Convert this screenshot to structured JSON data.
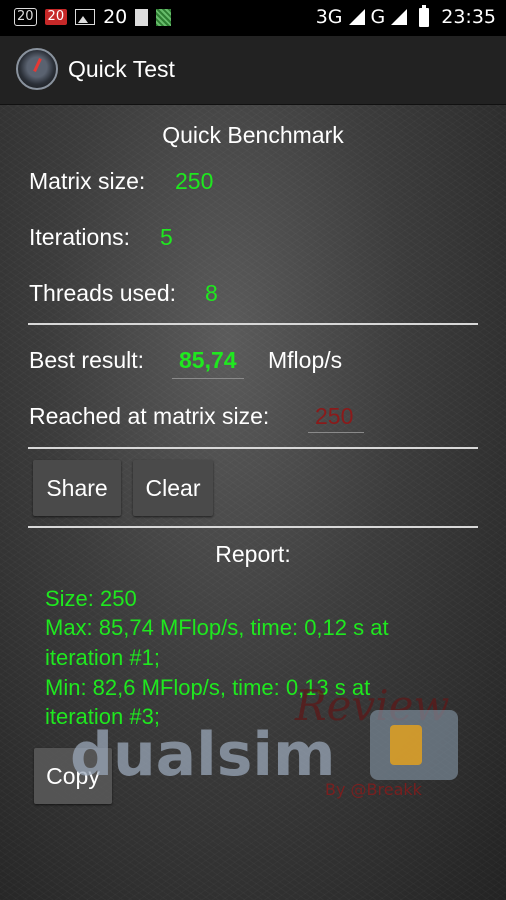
{
  "status_bar": {
    "notif_box_text": "20",
    "notif_red_text": "20",
    "notif_count": "20",
    "network_3g": "3G",
    "network_g": "G",
    "time": "23:35"
  },
  "action_bar": {
    "title": "Quick Test"
  },
  "benchmark": {
    "heading": "Quick Benchmark",
    "matrix_label": "Matrix size:",
    "matrix_value": "250",
    "iterations_label": "Iterations:",
    "iterations_value": "5",
    "threads_label": "Threads used:",
    "threads_value": "8",
    "best_label": "Best result:",
    "best_value": "85,74",
    "best_unit": "Mflop/s",
    "reached_label": "Reached at matrix size:",
    "reached_value": "250"
  },
  "buttons": {
    "share": "Share",
    "clear": "Clear",
    "copy": "Copy"
  },
  "report": {
    "heading": "Report:",
    "lines": [
      "Size: 250",
      "Max: 85,74 MFlop/s, time: 0,12 s at",
      "iteration #1;",
      "Min: 82,6 MFlop/s, time: 0,13 s at",
      "iteration #3;"
    ]
  },
  "watermark": {
    "brand": "dualsim",
    "review": "Review",
    "byline": "By @Breakk"
  },
  "colors": {
    "value_green": "#1fe81f",
    "reached_red": "#8b1a1a"
  }
}
